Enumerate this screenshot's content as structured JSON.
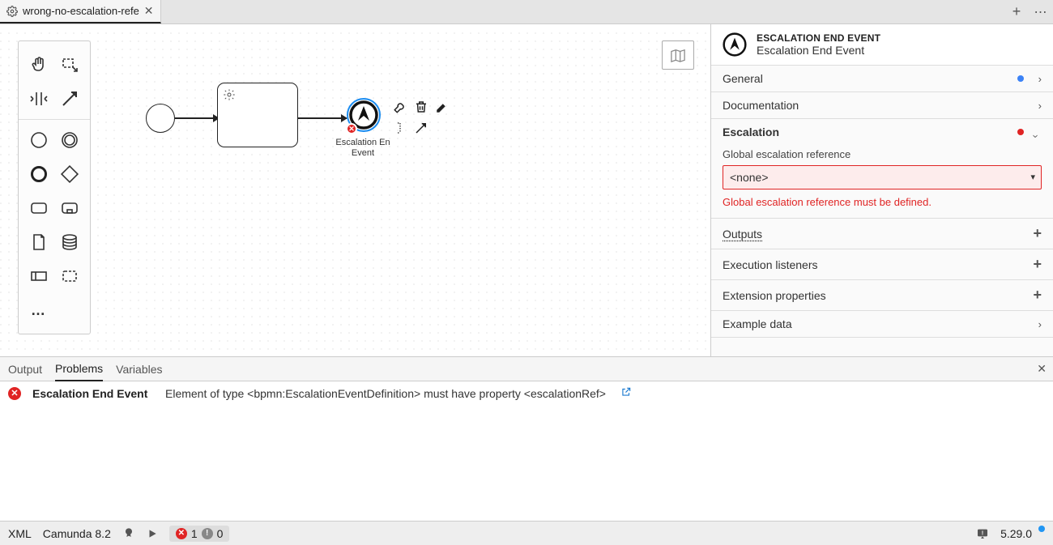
{
  "tab": {
    "title": "wrong-no-escalation-refe"
  },
  "canvas": {
    "element_label_line1": "Escalation En",
    "element_label_line2": "Event"
  },
  "props": {
    "type_label": "ESCALATION END EVENT",
    "name": "Escalation End Event",
    "sections": {
      "general": "General",
      "documentation": "Documentation",
      "escalation": "Escalation",
      "outputs": "Outputs",
      "exec_listeners": "Execution listeners",
      "ext_props": "Extension properties",
      "example_data": "Example data"
    },
    "escalation": {
      "field_label": "Global escalation reference",
      "value": "<none>",
      "error": "Global escalation reference must be defined."
    }
  },
  "bottom": {
    "tabs": {
      "output": "Output",
      "problems": "Problems",
      "variables": "Variables"
    },
    "item": {
      "name": "Escalation End Event",
      "msg": "Element of type <bpmn:EscalationEventDefinition> must have property <escalationRef>"
    }
  },
  "status": {
    "xml": "XML",
    "engine": "Camunda 8.2",
    "errors": "1",
    "warnings": "0",
    "version": "5.29.0"
  }
}
